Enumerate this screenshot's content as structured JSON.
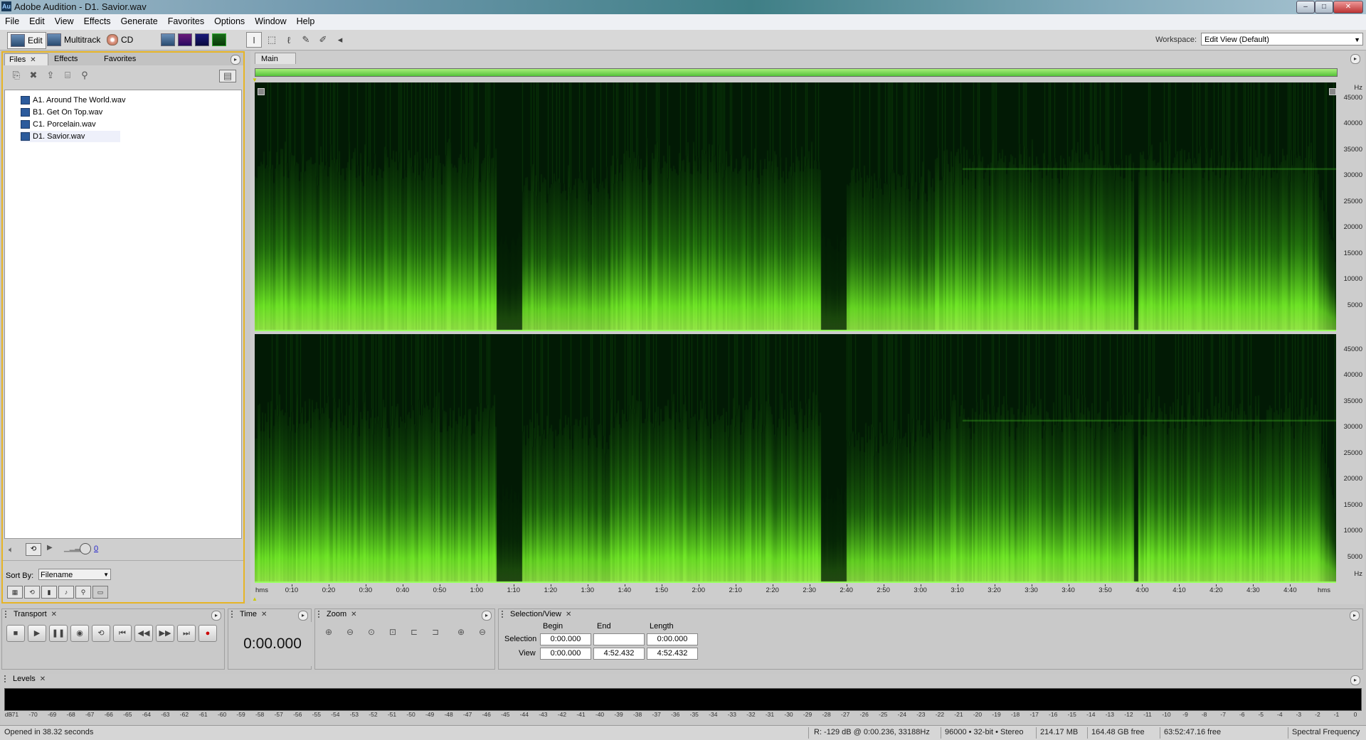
{
  "window": {
    "title": "Adobe Audition - D1. Savior.wav",
    "app_icon": "Au"
  },
  "menu": [
    "File",
    "Edit",
    "View",
    "Effects",
    "Generate",
    "Favorites",
    "Options",
    "Window",
    "Help"
  ],
  "toolbar": {
    "edit_label": "Edit",
    "multitrack_label": "Multitrack",
    "cd_label": "CD",
    "workspace_label": "Workspace:",
    "workspace_value": "Edit View (Default)"
  },
  "files_panel": {
    "tabs": [
      "Files",
      "Effects",
      "Favorites"
    ],
    "files": [
      "A1. Around The World.wav",
      "B1. Get On Top.wav",
      "C1. Porcelain.wav",
      "D1. Savior.wav"
    ],
    "selected_index": 3,
    "volume_value": "0",
    "sort_by_label": "Sort By:",
    "sort_by_value": "Filename"
  },
  "main_panel": {
    "tab": "Main",
    "hz_unit": "Hz",
    "hz_labels": [
      "45000",
      "40000",
      "35000",
      "30000",
      "25000",
      "20000",
      "15000",
      "10000",
      "5000"
    ],
    "time_unit": "hms",
    "time_labels": [
      "0:10",
      "0:20",
      "0:30",
      "0:40",
      "0:50",
      "1:00",
      "1:10",
      "1:20",
      "1:30",
      "1:40",
      "1:50",
      "2:00",
      "2:10",
      "2:20",
      "2:30",
      "2:40",
      "2:50",
      "3:00",
      "3:10",
      "3:20",
      "3:30",
      "3:40",
      "3:50",
      "4:00",
      "4:10",
      "4:20",
      "4:30",
      "4:40"
    ],
    "total_duration_seconds": 292.432,
    "spectral_colors": {
      "dark": "#021a05",
      "mid": "#1f8a10",
      "bright": "#7cff2a"
    }
  },
  "transport": {
    "title": "Transport"
  },
  "time_panel": {
    "title": "Time",
    "value": "0:00.000"
  },
  "zoom_panel": {
    "title": "Zoom"
  },
  "selection_view": {
    "title": "Selection/View",
    "headers": [
      "Begin",
      "End",
      "Length"
    ],
    "rows": [
      {
        "label": "Selection",
        "begin": "0:00.000",
        "end": "",
        "length": "0:00.000"
      },
      {
        "label": "View",
        "begin": "0:00.000",
        "end": "4:52.432",
        "length": "4:52.432"
      }
    ]
  },
  "levels_panel": {
    "title": "Levels",
    "scale_unit": "dB",
    "scale": [
      "-72",
      "-71",
      "-70",
      "-69",
      "-68",
      "-67",
      "-66",
      "-65",
      "-64",
      "-63",
      "-62",
      "-61",
      "-60",
      "-59",
      "-58",
      "-57",
      "-56",
      "-55",
      "-54",
      "-53",
      "-52",
      "-51",
      "-50",
      "-49",
      "-48",
      "-47",
      "-46",
      "-45",
      "-44",
      "-43",
      "-42",
      "-41",
      "-40",
      "-39",
      "-38",
      "-37",
      "-36",
      "-35",
      "-34",
      "-33",
      "-32",
      "-31",
      "-30",
      "-29",
      "-28",
      "-27",
      "-26",
      "-25",
      "-24",
      "-23",
      "-22",
      "-21",
      "-20",
      "-19",
      "-18",
      "-17",
      "-16",
      "-15",
      "-14",
      "-13",
      "-12",
      "-11",
      "-10",
      "-9",
      "-8",
      "-7",
      "-6",
      "-5",
      "-4",
      "-3",
      "-2",
      "-1",
      "0"
    ]
  },
  "status": {
    "message": "Opened in 38.32 seconds",
    "cursor": "R: -129 dB @   0:00.236, 33188Hz",
    "format": "96000 • 32-bit • Stereo",
    "file_size": "214.17 MB",
    "disk_free": "164.48 GB free",
    "time_free": "63:52:47.16 free",
    "view_mode": "Spectral Frequency"
  }
}
